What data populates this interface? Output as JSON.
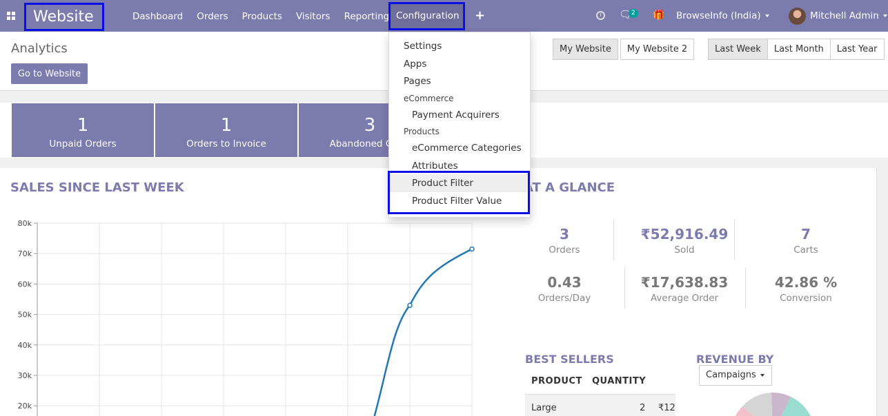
{
  "navbar": {
    "app_name": "Website",
    "menu": [
      "Dashboard",
      "Orders",
      "Products",
      "Visitors",
      "Reporting"
    ],
    "active_menu": "Configuration",
    "plus_label": "+",
    "chat_badge": "2",
    "company": "BrowseInfo (India)",
    "user": "Mitchell Admin",
    "icons": [
      "apps-icon",
      "clock-icon",
      "chat-icon",
      "gift-icon",
      "avatar"
    ]
  },
  "control_panel": {
    "breadcrumb": "Analytics",
    "go_button": "Go to Website",
    "websites": [
      "My Website",
      "My Website 2"
    ],
    "active_website": "My Website",
    "periods": [
      "Last Week",
      "Last Month",
      "Last Year"
    ],
    "active_period": "Last Week"
  },
  "tiles": [
    {
      "value": "1",
      "label": "Unpaid Orders"
    },
    {
      "value": "1",
      "label": "Orders to Invoice"
    },
    {
      "value": "3",
      "label": "Abandoned Carts"
    }
  ],
  "sales": {
    "title": "SALES SINCE LAST WEEK"
  },
  "chart_data": {
    "type": "line",
    "title": "",
    "xlabel": "",
    "ylabel": "",
    "y_ticks": [
      "20k",
      "30k",
      "40k",
      "50k",
      "60k",
      "70k",
      "80k"
    ],
    "ylim": [
      14000,
      80000
    ],
    "grid": true,
    "series": [
      {
        "color": "#1f77b4",
        "points": [
          {
            "x": 0,
            "y": 0
          },
          {
            "x": 1,
            "y": 0
          },
          {
            "x": 2,
            "y": 0
          },
          {
            "x": 3,
            "y": 0
          },
          {
            "x": 4,
            "y": 0
          },
          {
            "x": 5,
            "y": 0
          },
          {
            "x": 6,
            "y": 53000
          },
          {
            "x": 7,
            "y": 71500
          }
        ]
      }
    ]
  },
  "glance": {
    "title": "AT A GLANCE",
    "stats_row1": [
      {
        "value": "3",
        "label": "Orders"
      },
      {
        "value": "₹52,916.49",
        "label": "Sold"
      },
      {
        "value": "7",
        "label": "Carts"
      }
    ],
    "stats_row2": [
      {
        "value": "0.43",
        "label": "Orders/Day"
      },
      {
        "value": "₹17,638.83",
        "label": "Average Order"
      },
      {
        "value": "42.86 %",
        "label": "Conversion"
      }
    ]
  },
  "best_sellers": {
    "title": "BEST SELLERS",
    "columns": [
      "PRODUCT",
      "QUANTITY"
    ],
    "rows": [
      {
        "product": "Large",
        "quantity": "2",
        "amount": "₹12"
      }
    ]
  },
  "revenue": {
    "title": "REVENUE BY",
    "dropdown": "Campaigns",
    "pie_colors": [
      "#d5d5d5",
      "#cbb7cc",
      "#9adccf",
      "#f2c0c8"
    ]
  },
  "config_menu": {
    "items": [
      {
        "label": "Settings",
        "type": "item"
      },
      {
        "label": "Apps",
        "type": "item"
      },
      {
        "label": "Pages",
        "type": "item"
      },
      {
        "label": "eCommerce",
        "type": "header"
      },
      {
        "label": "Payment Acquirers",
        "type": "sub"
      },
      {
        "label": "Products",
        "type": "header"
      },
      {
        "label": "eCommerce Categories",
        "type": "sub"
      },
      {
        "label": "Attributes",
        "type": "sub"
      },
      {
        "label": "Product Filter",
        "type": "sub",
        "highlight": true
      },
      {
        "label": "Product Filter Value",
        "type": "sub"
      }
    ]
  }
}
